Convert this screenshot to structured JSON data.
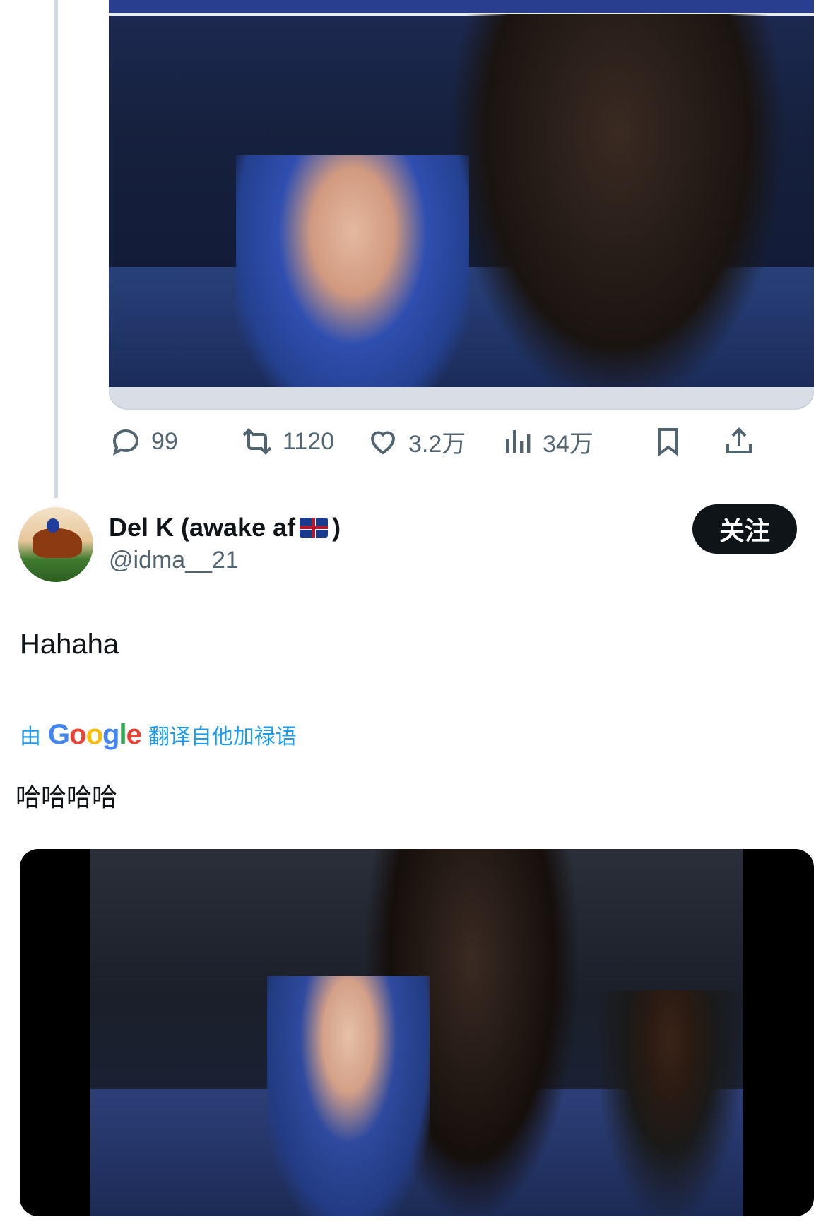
{
  "previous_tweet": {
    "media_alt": "",
    "stats": {
      "replies": "99",
      "retweets": "1120",
      "likes": "3.2万",
      "views": "34万"
    }
  },
  "reply": {
    "display_name": "Del K (awake af",
    "display_name_suffix": ")",
    "handle": "@idma__21",
    "follow_label": "关注",
    "text": "Hahaha",
    "translate": {
      "prefix": "由",
      "brand": "Google",
      "suffix": "翻译自他加禄语"
    },
    "translated_text": "哈哈哈哈"
  },
  "icons": [
    "reply-icon",
    "retweet-icon",
    "like-icon",
    "views-icon",
    "bookmark-icon",
    "share-icon",
    "uk-flag-icon"
  ]
}
